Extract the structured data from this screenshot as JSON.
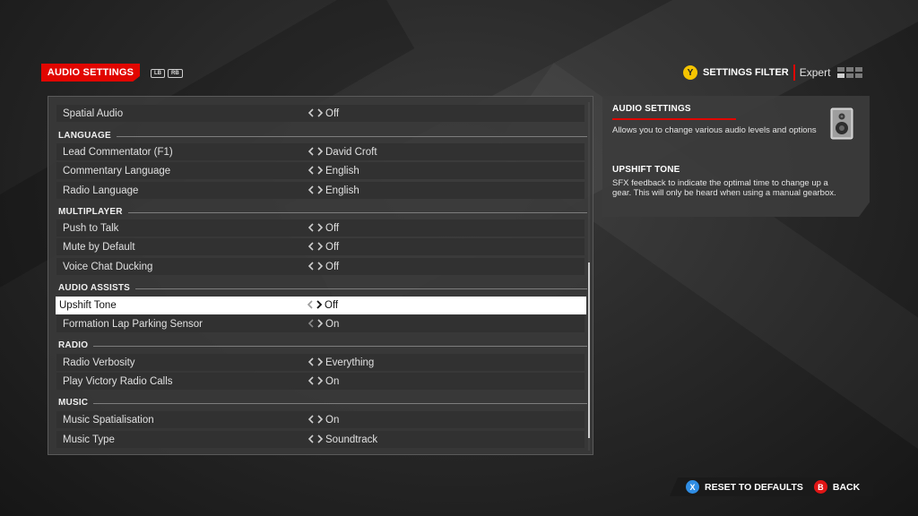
{
  "header": {
    "title": "AUDIO SETTINGS",
    "bumper_left": "LB",
    "bumper_right": "RB",
    "filter_button": "Y",
    "filter_label": "SETTINGS FILTER",
    "filter_value": "Expert"
  },
  "settings": {
    "rows": [
      {
        "label": "Spatial Audio",
        "value": "Off"
      },
      {
        "label": "Lead Commentator (F1)",
        "value": "David Croft"
      },
      {
        "label": "Commentary Language",
        "value": "English"
      },
      {
        "label": "Radio Language",
        "value": "English"
      },
      {
        "label": "Push to Talk",
        "value": "Off"
      },
      {
        "label": "Mute by Default",
        "value": "Off"
      },
      {
        "label": "Voice Chat Ducking",
        "value": "Off"
      },
      {
        "label": "Upshift Tone",
        "value": "Off"
      },
      {
        "label": "Formation Lap Parking Sensor",
        "value": "On"
      },
      {
        "label": "Radio Verbosity",
        "value": "Everything"
      },
      {
        "label": "Play Victory Radio Calls",
        "value": "On"
      },
      {
        "label": "Music Spatialisation",
        "value": "On"
      },
      {
        "label": "Music Type",
        "value": "Soundtrack"
      }
    ],
    "categories": [
      "LANGUAGE",
      "MULTIPLAYER",
      "AUDIO ASSISTS",
      "RADIO",
      "MUSIC"
    ]
  },
  "info": {
    "title": "AUDIO SETTINGS",
    "description": "Allows you to change various audio levels and options",
    "item_title": "UPSHIFT TONE",
    "item_description": "SFX feedback to indicate the optimal time to change up a gear. This will only be heard when using a manual gearbox."
  },
  "footer": {
    "reset_button": "X",
    "reset_label": "RESET TO DEFAULTS",
    "back_button": "B",
    "back_label": "BACK"
  },
  "colors": {
    "accent": "#e10600",
    "selected_row": "#ffffff",
    "y_button": "#f5c400",
    "x_button": "#2f8de4",
    "b_button": "#e01515"
  },
  "icons": {
    "row_arrows": "left-right-chevrons-icon",
    "info_image": "speaker-icon",
    "filter_level": "difficulty-bars-icon"
  }
}
